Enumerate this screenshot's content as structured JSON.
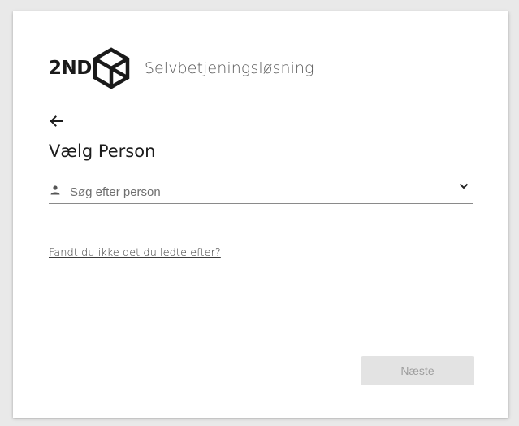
{
  "header": {
    "logo_text": "2ND",
    "app_title": "Selvbetjeningsløsning"
  },
  "navigation": {
    "back_icon": "arrow-left-icon"
  },
  "main": {
    "title": "Vælg Person",
    "search": {
      "placeholder": "Søg efter person",
      "value": "",
      "icon": "person-icon",
      "dropdown_icon": "chevron-down-icon"
    },
    "help_link": "Fandt du ikke det du ledte efter?"
  },
  "footer": {
    "next_label": "Næste",
    "next_disabled": true
  },
  "colors": {
    "background": "#e9e9e9",
    "card": "#ffffff",
    "button_disabled_bg": "#e3e3e3",
    "button_disabled_text": "#9e9e9e",
    "text_primary": "#1c1c1c"
  }
}
